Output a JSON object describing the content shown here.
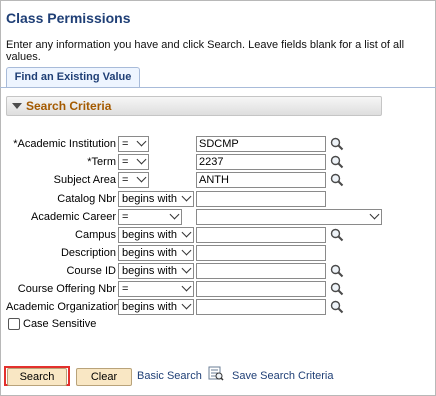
{
  "page": {
    "title": "Class Permissions",
    "instructions": "Enter any information you have and click Search. Leave fields blank for a list of all values."
  },
  "tabs": [
    {
      "label": "Find an Existing Value"
    }
  ],
  "criteria": {
    "section_title": "Search Criteria",
    "fields": [
      {
        "label": "*Academic Institution",
        "operator": "=",
        "value": "SDCMP",
        "lookup": true
      },
      {
        "label": "*Term",
        "operator": "=",
        "value": "2237",
        "lookup": true
      },
      {
        "label": "Subject Area",
        "operator": "=",
        "value": "ANTH",
        "lookup": true
      },
      {
        "label": "Catalog Nbr",
        "operator": "begins with",
        "value": ""
      },
      {
        "label": "Academic Career",
        "operator": "=",
        "value": ""
      },
      {
        "label": "Campus",
        "operator": "begins with",
        "value": "",
        "lookup": true
      },
      {
        "label": "Description",
        "operator": "begins with",
        "value": ""
      },
      {
        "label": "Course ID",
        "operator": "begins with",
        "value": "",
        "lookup": true
      },
      {
        "label": "Course Offering Nbr",
        "operator": "=",
        "value": "",
        "lookup": true
      },
      {
        "label": "Academic Organization",
        "operator": "begins with",
        "value": "",
        "lookup": true
      }
    ],
    "case_sensitive_label": "Case Sensitive",
    "case_sensitive_checked": false
  },
  "actions": {
    "search_label": "Search",
    "clear_label": "Clear",
    "basic_search_label": "Basic Search",
    "save_criteria_label": "Save Search Criteria"
  },
  "icons": {
    "lookup": "magnifier-icon",
    "save": "save-search-icon",
    "collapse": "triangle-down-icon"
  },
  "colors": {
    "title": "#1f3f76",
    "section_title": "#a45a00",
    "button_bg": "#f9e7c4",
    "highlight": "#e3302c"
  }
}
